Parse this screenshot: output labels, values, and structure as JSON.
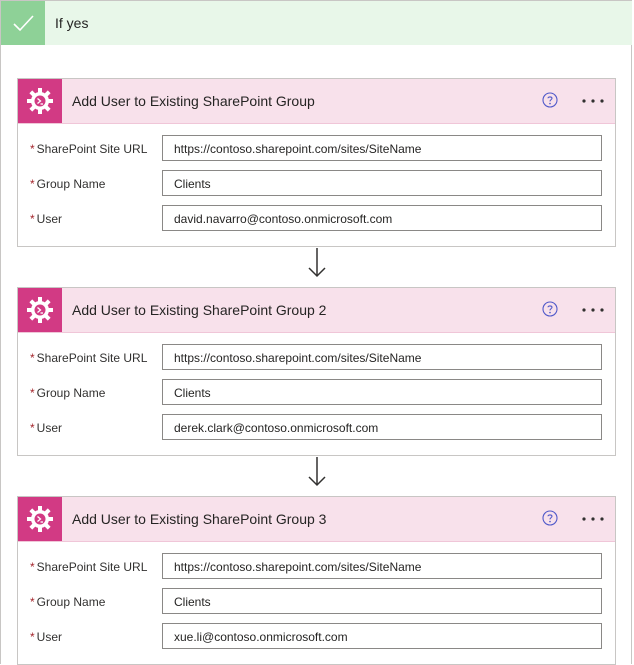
{
  "branch": {
    "label": "If yes",
    "icon": "checkmark-icon",
    "accent": "#8ed197",
    "background": "#e8f7e9"
  },
  "action_style": {
    "icon": "sharepoint-action-gear-icon",
    "icon_color": "#d23a84",
    "header_background": "#f8e1eb"
  },
  "actions": [
    {
      "title": "Add User to Existing SharePoint Group",
      "help_icon": "help-circle-icon",
      "more_icon": "more-options-icon",
      "fields": [
        {
          "label": "SharePoint Site URL",
          "required_mark": "*",
          "value": "https://contoso.sharepoint.com/sites/SiteName"
        },
        {
          "label": "Group Name",
          "required_mark": "*",
          "value": "Clients"
        },
        {
          "label": "User",
          "required_mark": "*",
          "value": "david.navarro@contoso.onmicrosoft.com"
        }
      ]
    },
    {
      "title": "Add User to Existing SharePoint Group 2",
      "help_icon": "help-circle-icon",
      "more_icon": "more-options-icon",
      "fields": [
        {
          "label": "SharePoint Site URL",
          "required_mark": "*",
          "value": "https://contoso.sharepoint.com/sites/SiteName"
        },
        {
          "label": "Group Name",
          "required_mark": "*",
          "value": "Clients"
        },
        {
          "label": "User",
          "required_mark": "*",
          "value": "derek.clark@contoso.onmicrosoft.com"
        }
      ]
    },
    {
      "title": "Add User to Existing SharePoint Group 3",
      "help_icon": "help-circle-icon",
      "more_icon": "more-options-icon",
      "fields": [
        {
          "label": "SharePoint Site URL",
          "required_mark": "*",
          "value": "https://contoso.sharepoint.com/sites/SiteName"
        },
        {
          "label": "Group Name",
          "required_mark": "*",
          "value": "Clients"
        },
        {
          "label": "User",
          "required_mark": "*",
          "value": "xue.li@contoso.onmicrosoft.com"
        }
      ]
    }
  ],
  "connector": {
    "icon": "down-arrow-icon"
  }
}
